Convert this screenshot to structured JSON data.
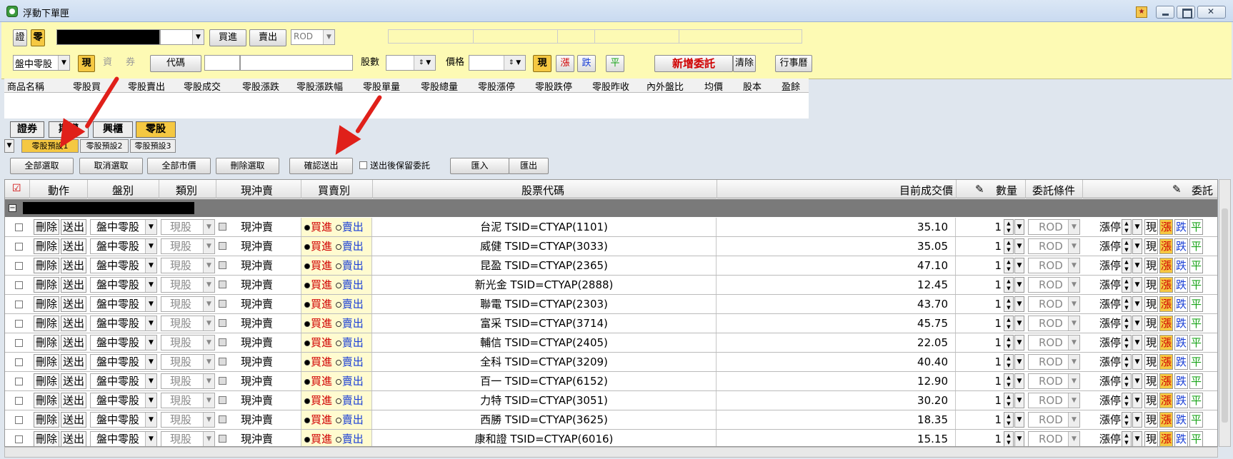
{
  "window": {
    "title": "浮動下單匣"
  },
  "order_panel": {
    "btn_securities": "證",
    "btn_odd": "零",
    "buy_btn": "買進",
    "sell_btn": "賣出",
    "order_type": "ROD",
    "session_select": "盤中零股",
    "btn_cash": "現",
    "btn_margin": "資",
    "btn_short": "券",
    "code_btn": "代碼",
    "qty_label": "股數",
    "price_label": "價格",
    "price_cash": "現",
    "price_up": "漲",
    "price_down": "跌",
    "price_flat": "平",
    "add_order_btn": "新增委託",
    "clear_btn": "清除",
    "calendar_btn": "行事曆"
  },
  "quote_columns": [
    "商品名稱",
    "零股買",
    "零股賣出",
    "零股成交",
    "零股漲跌",
    "零股漲跌幅",
    "零股單量",
    "零股總量",
    "零股漲停",
    "零股跌停",
    "零股昨收",
    "內外盤比",
    "均價",
    "股本",
    "盈餘"
  ],
  "category_tabs": [
    "證券",
    "期權",
    "興櫃",
    "零股"
  ],
  "preset_tabs": [
    "零股預設1",
    "零股預設2",
    "零股預設3"
  ],
  "actions": {
    "select_all": "全部選取",
    "deselect": "取消選取",
    "market_all": "全部市價",
    "delete_selected": "刪除選取",
    "confirm_send": "確認送出",
    "keep_after_send": "送出後保留委託",
    "import": "匯入",
    "export": "匯出"
  },
  "grid_headers": {
    "action": "動作",
    "session": "盤別",
    "type": "類別",
    "day_trade": "現沖賣",
    "side": "買賣別",
    "stock_code": "股票代碼",
    "last_price": "目前成交價",
    "qty": "數量",
    "condition": "委託條件",
    "order": "委託"
  },
  "row_labels": {
    "delete": "刪除",
    "send": "送出",
    "session": "盤中零股",
    "type": "現股",
    "day_trade": "現沖賣",
    "buy": "買進",
    "sell": "賣出",
    "qty": "1",
    "rod": "ROD",
    "limit": "漲停",
    "cash": "現",
    "up": "漲",
    "down": "跌",
    "flat": "平"
  },
  "rows": [
    {
      "stock": "台泥 TSID=CTYAP(1101)",
      "price": "35.10"
    },
    {
      "stock": "威健 TSID=CTYAP(3033)",
      "price": "35.05"
    },
    {
      "stock": "昆盈 TSID=CTYAP(2365)",
      "price": "47.10"
    },
    {
      "stock": "新光金 TSID=CTYAP(2888)",
      "price": "12.45"
    },
    {
      "stock": "聯電 TSID=CTYAP(2303)",
      "price": "43.70"
    },
    {
      "stock": "富采 TSID=CTYAP(3714)",
      "price": "45.75"
    },
    {
      "stock": "輔信 TSID=CTYAP(2405)",
      "price": "22.05"
    },
    {
      "stock": "全科 TSID=CTYAP(3209)",
      "price": "40.40"
    },
    {
      "stock": "百一 TSID=CTYAP(6152)",
      "price": "12.90"
    },
    {
      "stock": "力特 TSID=CTYAP(3051)",
      "price": "30.20"
    },
    {
      "stock": "西勝 TSID=CTYAP(3625)",
      "price": "18.35"
    },
    {
      "stock": "康和證 TSID=CTYAP(6016)",
      "price": "15.15"
    }
  ],
  "colors": {
    "accent_yellow": "#f5c842",
    "panel_yellow": "#fdfab4",
    "arrow_red": "#e0201a",
    "buy_red": "#d00000",
    "sell_blue": "#1a3fd6"
  }
}
